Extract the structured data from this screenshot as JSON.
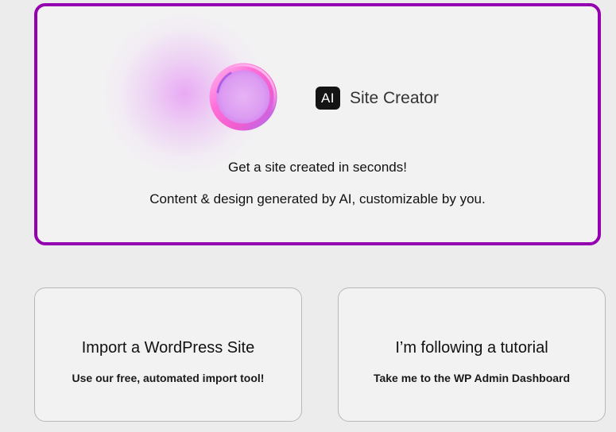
{
  "site_creator": {
    "badge": "AI",
    "title": "Site Creator",
    "tagline": "Get a site created in seconds!",
    "description": "Content & design generated by AI, customizable by you."
  },
  "options": [
    {
      "title": "Import a WordPress Site",
      "subtitle": "Use our free, automated import tool!"
    },
    {
      "title": "I’m following a tutorial",
      "subtitle": "Take me to the WP Admin Dashboard"
    }
  ],
  "colors": {
    "accent_border": "#9400b0",
    "card_background": "#f2f2f3",
    "page_background": "#ececec",
    "orb_pink": "#ff6fd8",
    "orb_purple": "#b06cf0"
  }
}
